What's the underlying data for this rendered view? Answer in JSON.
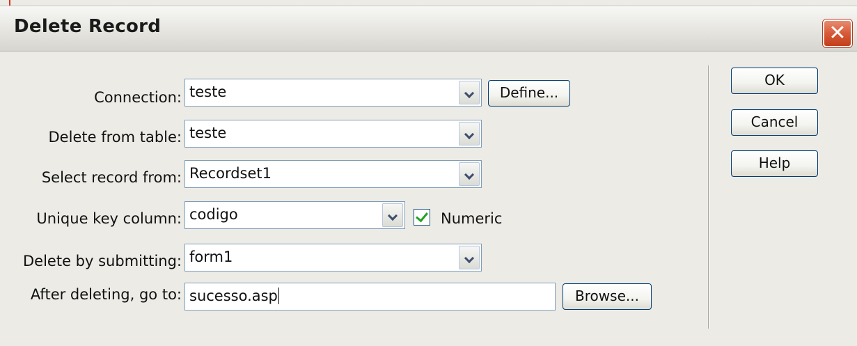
{
  "dialog": {
    "title": "Delete Record",
    "close_icon": "close-icon"
  },
  "fields": {
    "connection": {
      "label": "Connection:",
      "value": "teste",
      "define_label": "Define..."
    },
    "delete_from_table": {
      "label": "Delete from table:",
      "value": "teste"
    },
    "select_record_from": {
      "label": "Select record from:",
      "value": "Recordset1"
    },
    "unique_key_column": {
      "label": "Unique key column:",
      "value": "codigo",
      "numeric_label": "Numeric",
      "numeric_checked": true
    },
    "delete_by_submitting": {
      "label": "Delete by submitting:",
      "value": "form1"
    },
    "after_deleting": {
      "label": "After deleting, go to:",
      "value": "sucesso.asp",
      "browse_label": "Browse..."
    }
  },
  "buttons": {
    "ok": "OK",
    "cancel": "Cancel",
    "help": "Help"
  },
  "colors": {
    "close_button": "#d75a37",
    "checkmark": "#21a121",
    "field_border": "#7f9db9",
    "button_border": "#003c74"
  }
}
